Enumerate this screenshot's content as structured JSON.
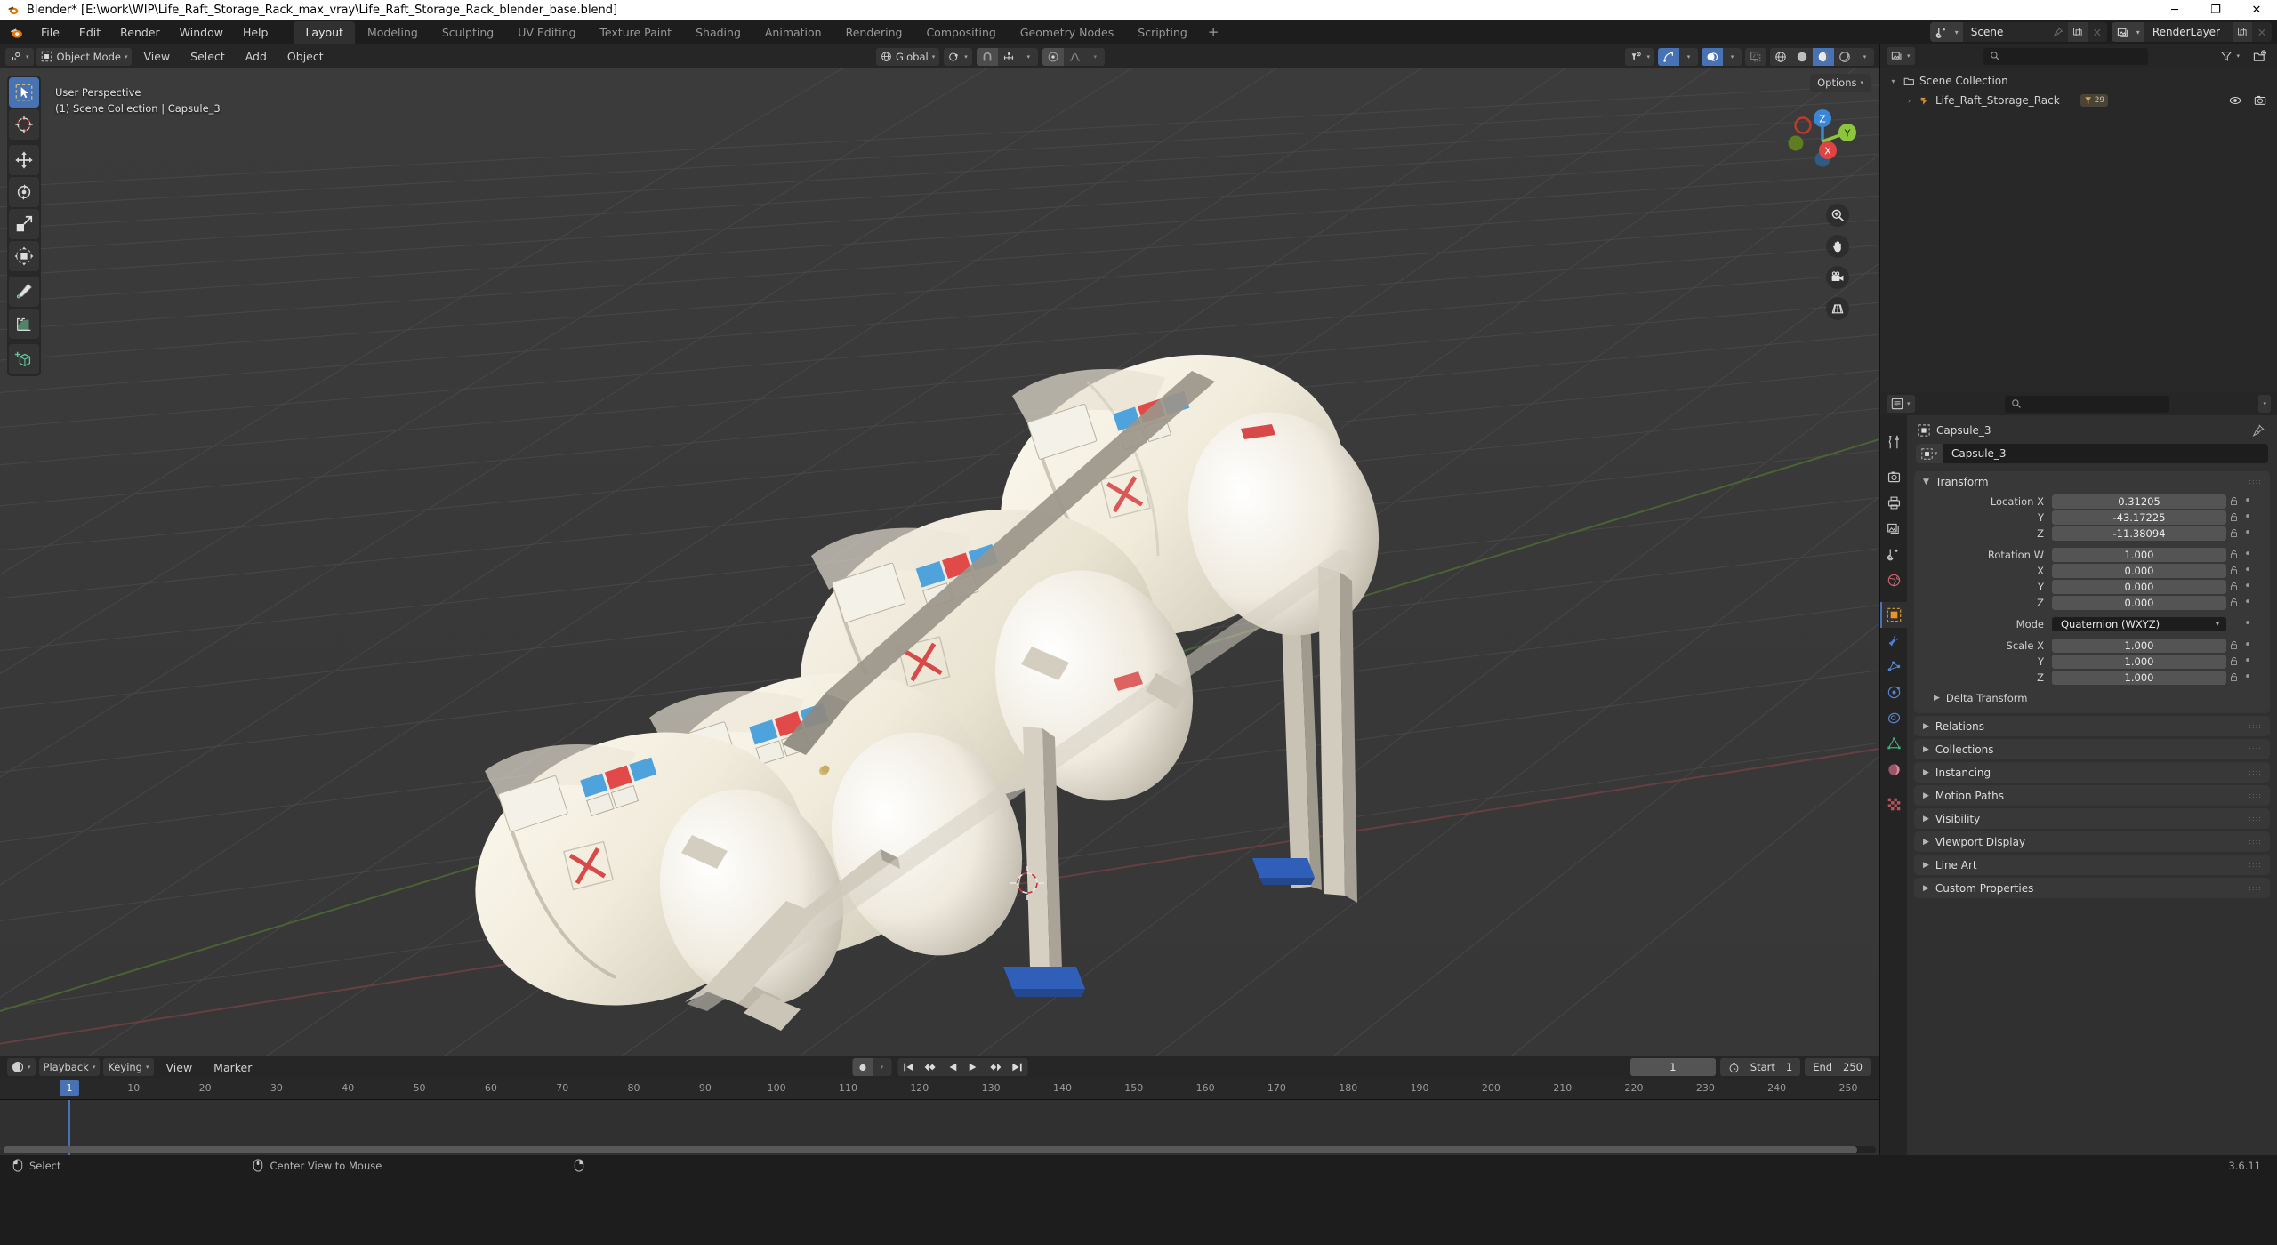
{
  "window": {
    "title": "Blender* [E:\\work\\WIP\\Life_Raft_Storage_Rack_max_vray\\Life_Raft_Storage_Rack_blender_base.blend]",
    "minimize": "─",
    "maximize": "❐",
    "close": "✕"
  },
  "topbar": {
    "menus": [
      "File",
      "Edit",
      "Render",
      "Window",
      "Help"
    ],
    "workspaces": [
      {
        "label": "Layout",
        "active": true
      },
      {
        "label": "Modeling",
        "active": false
      },
      {
        "label": "Sculpting",
        "active": false
      },
      {
        "label": "UV Editing",
        "active": false
      },
      {
        "label": "Texture Paint",
        "active": false
      },
      {
        "label": "Shading",
        "active": false
      },
      {
        "label": "Animation",
        "active": false
      },
      {
        "label": "Rendering",
        "active": false
      },
      {
        "label": "Compositing",
        "active": false
      },
      {
        "label": "Geometry Nodes",
        "active": false
      },
      {
        "label": "Scripting",
        "active": false
      }
    ],
    "add_workspace": "+",
    "scene": {
      "name": "Scene",
      "icon": "scene-icon"
    },
    "view_layer": {
      "name": "RenderLayer",
      "icon": "viewlayer-icon"
    }
  },
  "viewport_header": {
    "editor_type": "editor-type-icon",
    "mode": "Object Mode",
    "menus": [
      "View",
      "Select",
      "Add",
      "Object"
    ],
    "transform_orientation": "Global",
    "snap_label": "snap-magnet-icon",
    "proportional_label": "proportional-edit-icon",
    "shading_modes": [
      "wireframe",
      "solid",
      "material-preview",
      "rendered"
    ],
    "active_shading": "material-preview",
    "options": "Options"
  },
  "viewport": {
    "overlay_line1": "User Perspective",
    "overlay_line2": "(1) Scene Collection | Capsule_3",
    "gizmo_axes": [
      "X",
      "Y",
      "Z"
    ],
    "nav_buttons": [
      "zoom-icon",
      "pan-hand-icon",
      "camera-view-icon",
      "toggle-ortho-icon"
    ],
    "tools": [
      {
        "name": "tweak-select-tool",
        "active": true
      },
      {
        "name": "cursor-tool",
        "active": false
      },
      {
        "name": "move-tool",
        "active": false
      },
      {
        "name": "rotate-tool",
        "active": false
      },
      {
        "name": "scale-tool",
        "active": false
      },
      {
        "name": "transform-tool",
        "active": false
      },
      {
        "name": "annotate-tool",
        "active": false
      },
      {
        "name": "measure-tool",
        "active": false
      },
      {
        "name": "add-cube-tool",
        "active": false
      }
    ]
  },
  "outliner": {
    "display_mode": "view-layer-icon",
    "search_placeholder": "",
    "filter_icon": "filter-icon",
    "new_collection_icon": "new-collection-icon",
    "rows": [
      {
        "label": "Scene Collection",
        "indent": 0,
        "icon": "collection-icon",
        "twisty": "",
        "badge": null
      },
      {
        "label": "Life_Raft_Storage_Rack",
        "indent": 1,
        "icon": "object-mesh-icon",
        "twisty": "›",
        "badge": "29"
      }
    ]
  },
  "properties": {
    "search_placeholder": "",
    "breadcrumb": "Capsule_3",
    "object_name": "Capsule_3",
    "tabs": [
      {
        "name": "tool-tab",
        "active": false
      },
      {
        "name": "render-tab",
        "active": false
      },
      {
        "name": "output-tab",
        "active": false
      },
      {
        "name": "view-layer-tab",
        "active": false
      },
      {
        "name": "scene-tab",
        "active": false
      },
      {
        "name": "world-tab",
        "active": false
      },
      {
        "name": "object-tab",
        "active": true
      },
      {
        "name": "modifiers-tab",
        "active": false
      },
      {
        "name": "particles-tab",
        "active": false
      },
      {
        "name": "physics-tab",
        "active": false
      },
      {
        "name": "constraints-tab",
        "active": false
      },
      {
        "name": "object-data-tab",
        "active": false
      },
      {
        "name": "material-tab",
        "active": false
      },
      {
        "name": "texture-tab",
        "active": false
      }
    ],
    "transform_panel": {
      "title": "Transform",
      "expanded": true,
      "rows": [
        {
          "label": "Location X",
          "value": "0.31205",
          "group": 0
        },
        {
          "label": "Y",
          "value": "-43.17225",
          "group": 0
        },
        {
          "label": "Z",
          "value": "-11.38094",
          "group": 0
        },
        {
          "label": "Rotation W",
          "value": "1.000",
          "group": 1
        },
        {
          "label": "X",
          "value": "0.000",
          "group": 1
        },
        {
          "label": "Y",
          "value": "0.000",
          "group": 1
        },
        {
          "label": "Z",
          "value": "0.000",
          "group": 1
        }
      ],
      "mode_label": "Mode",
      "mode_value": "Quaternion (WXYZ)",
      "scale_rows": [
        {
          "label": "Scale X",
          "value": "1.000"
        },
        {
          "label": "Y",
          "value": "1.000"
        },
        {
          "label": "Z",
          "value": "1.000"
        }
      ],
      "delta_transform": "Delta Transform"
    },
    "collapsed_panels": [
      "Relations",
      "Collections",
      "Instancing",
      "Motion Paths",
      "Visibility",
      "Viewport Display",
      "Line Art",
      "Custom Properties"
    ]
  },
  "timeline": {
    "editor_icon": "timeline-icon",
    "menus": [
      "Playback",
      "Keying",
      "View",
      "Marker"
    ],
    "record_icon": "record-icon",
    "transport": [
      "jump-start",
      "prev-keyframe",
      "play-reverse",
      "play",
      "next-keyframe",
      "jump-end"
    ],
    "current_frame": "1",
    "start_label": "Start",
    "start_value": "1",
    "end_label": "End",
    "end_value": "250",
    "ticks": [
      {
        "label": "1",
        "frame": 1
      },
      {
        "label": "10",
        "frame": 10
      },
      {
        "label": "20",
        "frame": 20
      },
      {
        "label": "30",
        "frame": 30
      },
      {
        "label": "40",
        "frame": 40
      },
      {
        "label": "50",
        "frame": 50
      },
      {
        "label": "60",
        "frame": 60
      },
      {
        "label": "70",
        "frame": 70
      },
      {
        "label": "80",
        "frame": 80
      },
      {
        "label": "90",
        "frame": 90
      },
      {
        "label": "100",
        "frame": 100
      },
      {
        "label": "110",
        "frame": 110
      },
      {
        "label": "120",
        "frame": 120
      },
      {
        "label": "130",
        "frame": 130
      },
      {
        "label": "140",
        "frame": 140
      },
      {
        "label": "150",
        "frame": 150
      },
      {
        "label": "160",
        "frame": 160
      },
      {
        "label": "170",
        "frame": 170
      },
      {
        "label": "180",
        "frame": 180
      },
      {
        "label": "190",
        "frame": 190
      },
      {
        "label": "200",
        "frame": 200
      },
      {
        "label": "210",
        "frame": 210
      },
      {
        "label": "220",
        "frame": 220
      },
      {
        "label": "230",
        "frame": 230
      },
      {
        "label": "240",
        "frame": 240
      },
      {
        "label": "250",
        "frame": 250
      }
    ]
  },
  "statusbar": {
    "items": [
      {
        "icon": "mouse-left-icon",
        "label": "Select"
      },
      {
        "icon": "mouse-middle-icon",
        "label": "Center View to Mouse"
      },
      {
        "icon": "mouse-right-icon",
        "label": ""
      }
    ],
    "version": "3.6.11"
  },
  "colors": {
    "accent_blue": "#4772b3",
    "axis_x_red": "#e04343",
    "axis_y_green": "#8cc63f",
    "axis_z_blue": "#3b87d6",
    "panel_bg": "#383838",
    "editor_bg": "#303030",
    "header_bg": "#262626",
    "window_bg": "#1d1d1d",
    "viewport_bg": "#3c3c3c",
    "capsule_cream": "#f2eddf",
    "rack_gray": "#cfc9bd",
    "foot_blue": "#2f5fb8"
  }
}
